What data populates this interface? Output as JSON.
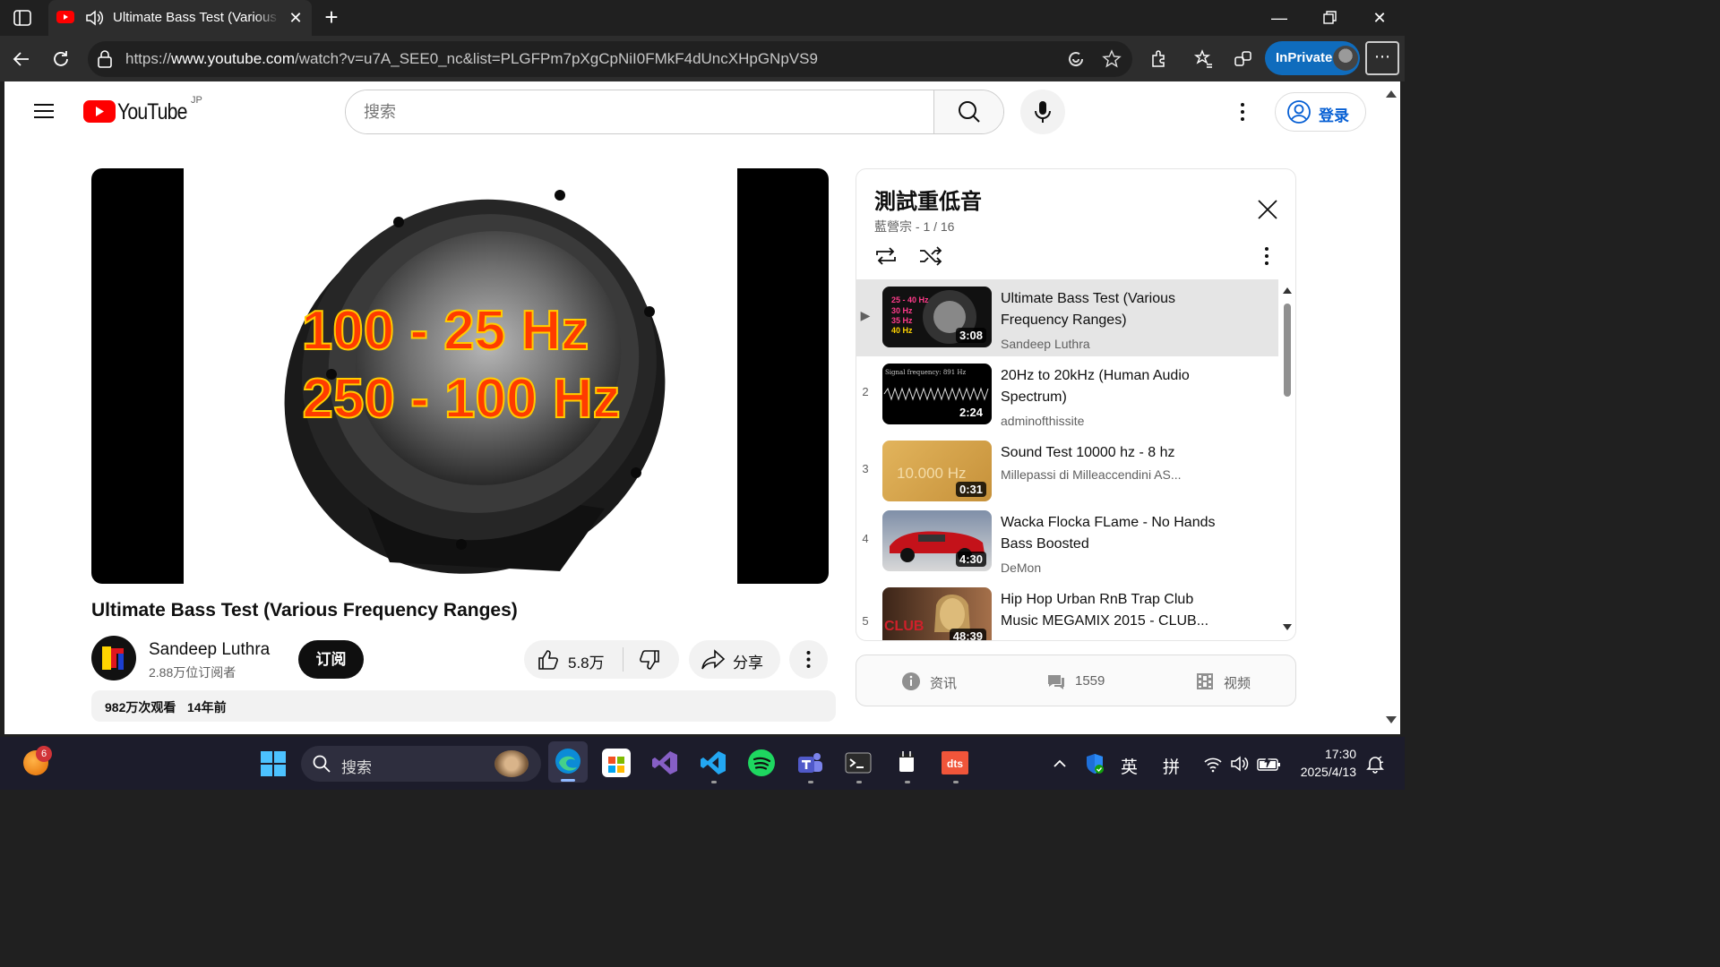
{
  "browser": {
    "tab_title": "Ultimate Bass Test (Various Fr",
    "url_prefix": "https://",
    "url_host": "www.youtube.com",
    "url_path": "/watch?v=u7A_SEE0_nc&list=PLGFPm7pXgCpNiI0FMkF4dUncXHpGNpVS9",
    "inprivate_label": "InPrivate"
  },
  "header": {
    "logo_text": "YouTube",
    "region": "JP",
    "search_placeholder": "搜索",
    "signin_label": "登录"
  },
  "video": {
    "overlay_line1": "100 - 25 Hz",
    "overlay_line2": "250 - 100 Hz",
    "title": "Ultimate Bass Test (Various Frequency Ranges)",
    "channel_name": "Sandeep Luthra",
    "subscribers": "2.88万位订阅者",
    "subscribe_label": "订阅",
    "likes": "5.8万",
    "share_label": "分享",
    "views": "982万次观看",
    "age": "14年前"
  },
  "playlist": {
    "title": "測試重低音",
    "meta": "藍營宗 - 1 / 16",
    "items": [
      {
        "index": "▶",
        "title": "Ultimate Bass Test (Various Frequency Ranges)",
        "channel": "Sandeep Luthra",
        "duration": "3:08",
        "thumb_text": "25 - 40 Hz\n30 Hz\n35 Hz\n40 Hz"
      },
      {
        "index": "2",
        "title": "20Hz to 20kHz (Human Audio Spectrum)",
        "channel": "adminofthissite",
        "duration": "2:24",
        "thumb_text": "Signal frequency: 891 Hz"
      },
      {
        "index": "3",
        "title": "Sound Test 10000 hz - 8 hz",
        "channel": "Millepassi di Milleaccendini AS...",
        "duration": "0:31",
        "thumb_text": "10.000 Hz"
      },
      {
        "index": "4",
        "title": "Wacka Flocka FLame - No Hands Bass Boosted",
        "channel": "DeMon",
        "duration": "4:30",
        "thumb_text": ""
      },
      {
        "index": "5",
        "title": "Hip Hop Urban RnB Trap Club Music MEGAMIX 2015 - CLUB...",
        "channel": "",
        "duration": "48:39",
        "thumb_text": "CLUB"
      }
    ]
  },
  "info_panel": {
    "info_label": "资讯",
    "comments_count": "1559",
    "video_label": "视频"
  },
  "taskbar": {
    "search_placeholder": "搜索",
    "badge_count": "6",
    "ime1": "英",
    "ime2": "拼",
    "time": "17:30",
    "date": "2025/4/13"
  }
}
